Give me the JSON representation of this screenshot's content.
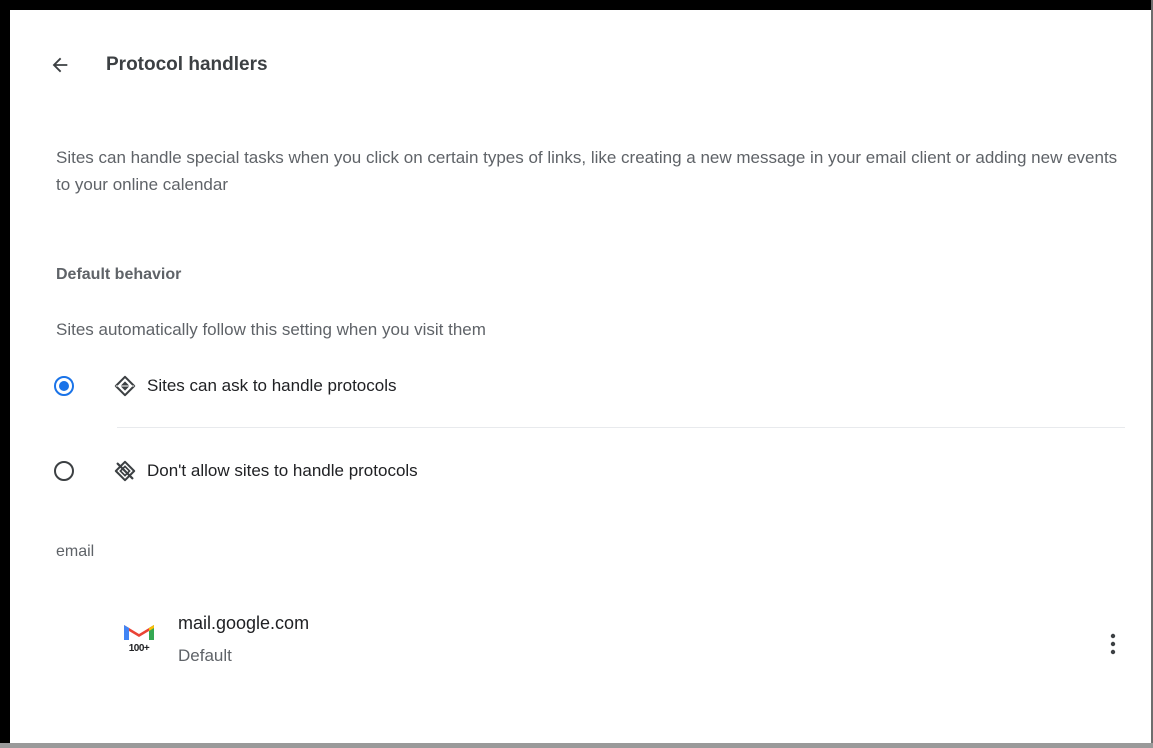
{
  "header": {
    "title": "Protocol handlers",
    "back_icon": "arrow-back-icon"
  },
  "description": "Sites can handle special tasks when you click on certain types of links, like creating a new message in your email client or adding new events to your online calendar",
  "default_behavior": {
    "heading": "Default behavior",
    "subtitle": "Sites automatically follow this setting when you visit them",
    "options": [
      {
        "label": "Sites can ask to handle protocols",
        "icon": "protocol-handler-icon",
        "selected": true
      },
      {
        "label": "Don't allow sites to handle protocols",
        "icon": "protocol-handler-off-icon",
        "selected": false
      }
    ]
  },
  "handlers": {
    "category": "email",
    "items": [
      {
        "site": "mail.google.com",
        "status": "Default",
        "icon": "gmail-icon",
        "badge": "100+",
        "menu_icon": "more-vert-icon"
      }
    ]
  },
  "colors": {
    "accent": "#1a73e8",
    "text_primary": "#202124",
    "text_secondary": "#5f6368"
  }
}
